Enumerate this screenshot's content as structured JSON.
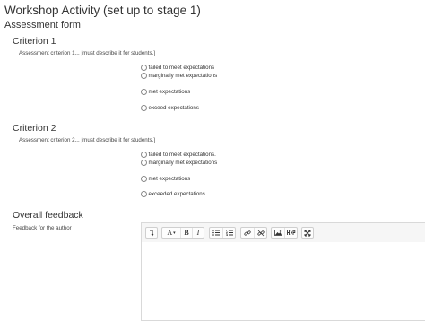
{
  "page": {
    "title": "Workshop Activity (set up to stage 1)",
    "form_title": "Assessment form"
  },
  "criteria": [
    {
      "heading": "Criterion 1",
      "description": "Assessment criterion 1... [must describe it for students.]",
      "options": [
        "failed to meet expectations",
        "marginally met expectations",
        "met expectations",
        "exceed expectations"
      ]
    },
    {
      "heading": "Criterion 2",
      "description": "Assessment criterion 2... [must describe it for students.]",
      "options": [
        "failed to meet expectations.",
        "marginally met expectations",
        "met expectations",
        "exceeded expectations"
      ]
    }
  ],
  "feedback": {
    "heading": "Overall feedback",
    "label": "Feedback for the author",
    "toolbar": {
      "toggle": "show-more-icon",
      "font": "A",
      "bold": "B",
      "italic": "I",
      "unordered_list": "bullet-list-icon",
      "ordered_list": "numbered-list-icon",
      "link": "link-icon",
      "unlink": "unlink-icon",
      "image": "image-icon",
      "media": "media-icon",
      "fullscreen": "fullscreen-icon"
    }
  }
}
